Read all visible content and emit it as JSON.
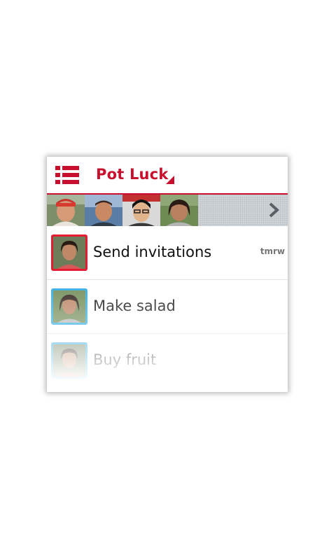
{
  "header": {
    "title": "Pot Luck",
    "menu_icon": "list-menu-icon",
    "dropdown_icon": "dropdown-triangle-icon",
    "accent_color": "#c8102e"
  },
  "participants": {
    "avatars": [
      "person-1",
      "person-2",
      "person-3",
      "person-4"
    ],
    "more_icon": "chevron-right-icon"
  },
  "tasks": [
    {
      "label": "Send invitations",
      "meta": "tmrw",
      "avatar_border_color": "#e51c32"
    },
    {
      "label": "Make salad",
      "meta": "",
      "avatar_border_color": "#29a9e0"
    },
    {
      "label": "Buy fruit",
      "meta": "",
      "avatar_border_color": "#29a9e0"
    }
  ]
}
